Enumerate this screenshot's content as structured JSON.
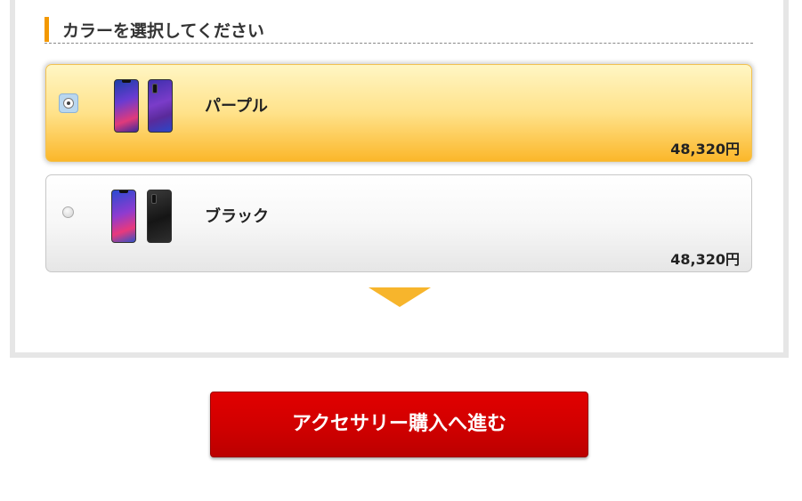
{
  "section": {
    "heading": "カラーを選択してください"
  },
  "options": [
    {
      "name": "パープル",
      "price": "48,320円",
      "selected": true,
      "icon": "purple-phone-image"
    },
    {
      "name": "ブラック",
      "price": "48,320円",
      "selected": false,
      "icon": "black-phone-image"
    }
  ],
  "colors": {
    "accent": "#f39800",
    "selected_gradient_end": "#fbb72a",
    "arrow": "#f7b52c",
    "button": "#d00000"
  },
  "icons": {
    "step_arrow": "chevron-down-icon"
  },
  "proceed_button": {
    "label": "アクセサリー購入へ進む"
  }
}
